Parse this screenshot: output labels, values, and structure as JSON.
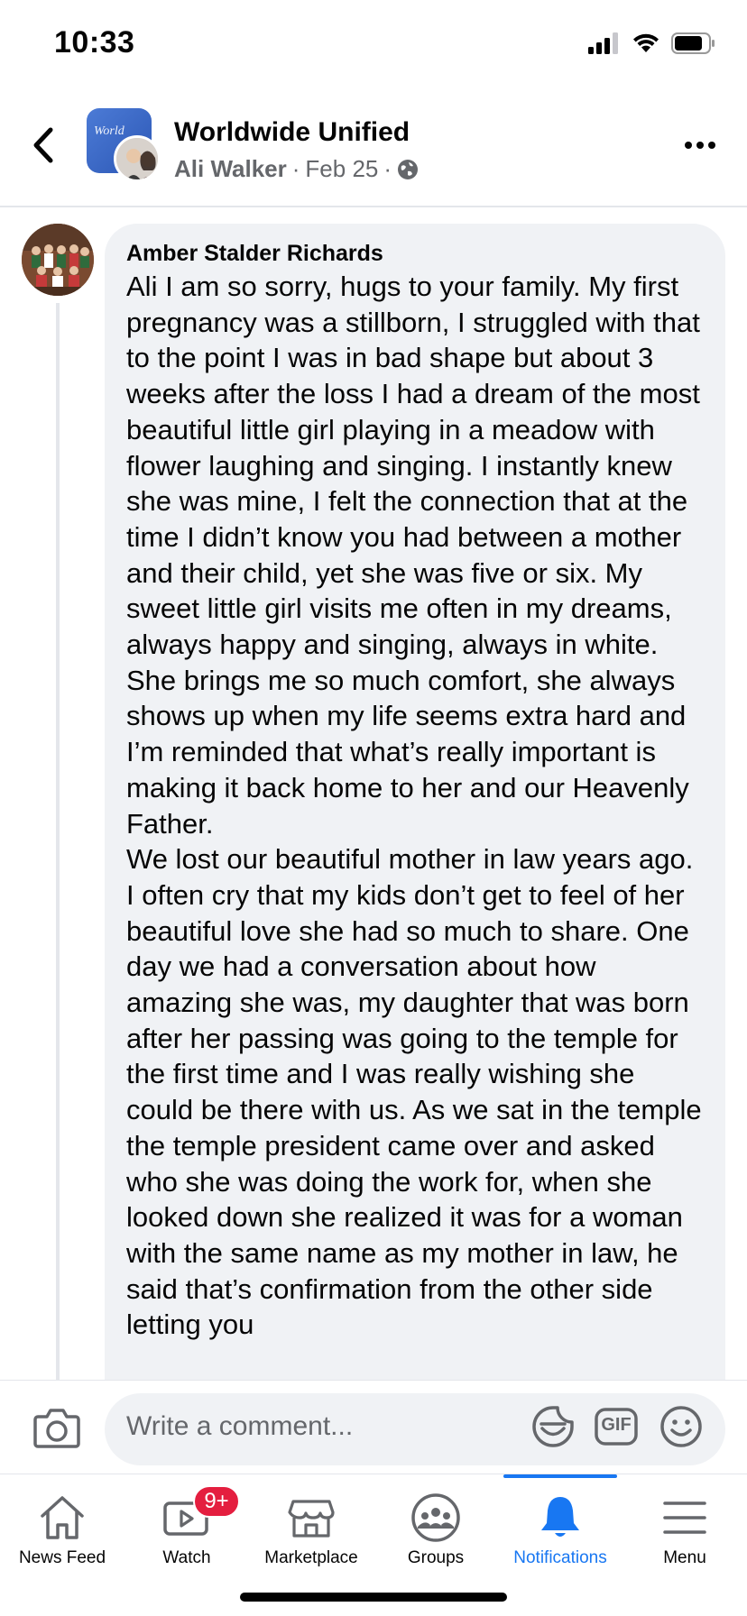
{
  "status_bar": {
    "time": "10:33",
    "icons": [
      "cellular-signal-icon",
      "wifi-icon",
      "battery-icon"
    ]
  },
  "header": {
    "group_name": "Worldwide Unified",
    "group_avatar_text": "World",
    "author": "Ali Walker",
    "separator": "·",
    "date": "Feb 25",
    "audience_icon": "globe-icon",
    "back_icon": "chevron-left-icon",
    "more_icon": "more-horizontal-icon"
  },
  "comment": {
    "author": "Amber Stalder Richards",
    "text": "Ali I am so sorry, hugs to your family. My first pregnancy was a stillborn, I struggled with that to the point I was in bad shape but about 3 weeks after the loss I had a dream of the most beautiful little girl playing in a meadow with flower laughing and singing. I instantly knew she was mine, I felt the connection that at the time I didn’t know you had between a mother and their child, yet she was five or six. My sweet little girl visits me often in my dreams, always happy and singing, always in white. She brings me so much comfort, she always shows up when my life seems extra hard and I’m reminded that what’s really important is making it back home to her and our Heavenly Father.\nWe lost our beautiful mother in law years ago. I often cry that my kids don’t get to feel of her beautiful love she had so much to share. One day we had a conversation about how amazing she was, my daughter that was born after her passing was going to the temple for the first time and I was really wishing she could be there with us. As we sat in the temple the temple president came over and asked who she was doing the work for, when she looked down she realized it was for a woman with the same name as my mother in law, he said that’s confirmation from the other side letting you"
  },
  "composer": {
    "placeholder": "Write a comment...",
    "camera_icon": "camera-icon",
    "sticker_icon": "sticker-icon",
    "gif_label": "GIF",
    "emoji_icon": "smiley-icon"
  },
  "bottom_nav": {
    "items": [
      {
        "label": "News Feed",
        "icon": "home-icon"
      },
      {
        "label": "Watch",
        "icon": "video-play-icon",
        "badge": "9+"
      },
      {
        "label": "Marketplace",
        "icon": "storefront-icon"
      },
      {
        "label": "Groups",
        "icon": "groups-icon"
      },
      {
        "label": "Notifications",
        "icon": "bell-icon",
        "active": true
      },
      {
        "label": "Menu",
        "icon": "hamburger-menu-icon"
      }
    ]
  },
  "colors": {
    "accent": "#1877f2",
    "badge": "#e41e3f",
    "bubble": "#f0f2f5",
    "secondary_text": "#65676b"
  }
}
